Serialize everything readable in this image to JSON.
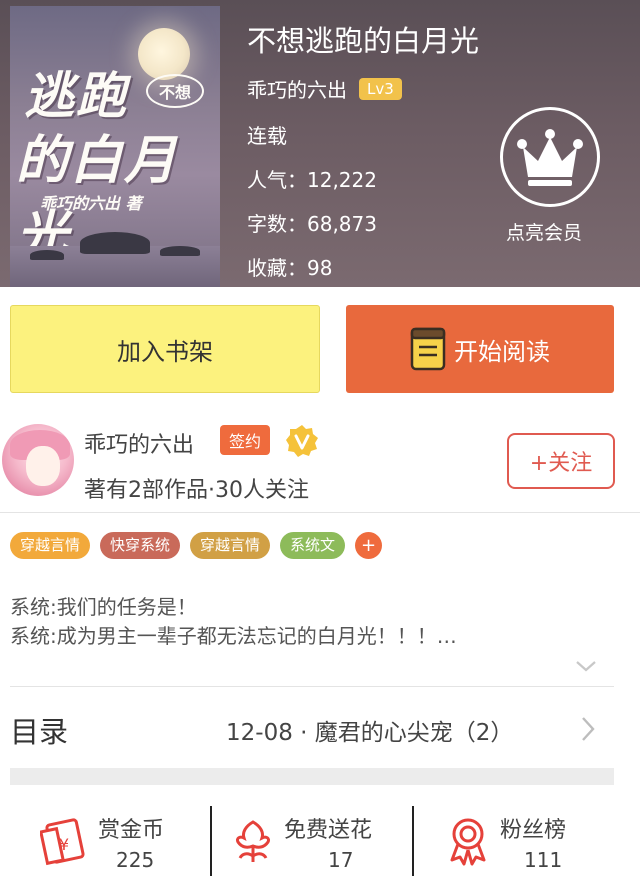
{
  "book": {
    "title": "不想逃跑的白月光",
    "author": "乖巧的六出",
    "level": "Lv3",
    "status": "连载",
    "popularity": "人气：12,222",
    "word_count": "字数：68,873",
    "favorites": "收藏：98",
    "cover": {
      "line1": "逃跑",
      "badge": "不想",
      "line2": "的白月光",
      "author": "乖巧的六出 著"
    }
  },
  "vip": {
    "label": "点亮会员",
    "icon": "crown-icon"
  },
  "actions": {
    "add_shelf": "加入书架",
    "start_read": "开始阅读",
    "read_icon": "book-icon"
  },
  "author_info": {
    "name": "乖巧的六出",
    "signed": "签约",
    "stats": "著有2部作品·30人关注",
    "follow": "+关注",
    "verified_icon": "v-badge-icon"
  },
  "tags": [
    {
      "label": "穿越言情",
      "color": "#f2a93b"
    },
    {
      "label": "快穿系统",
      "color": "#c96a5a"
    },
    {
      "label": "穿越言情",
      "color": "#d1a045"
    },
    {
      "label": "系统文",
      "color": "#8dbb5a"
    }
  ],
  "tag_more": "+",
  "description": {
    "line1": "系统:我们的任务是！",
    "line2": "系统:成为男主一辈子都无法忘记的白月光！！！…"
  },
  "toc": {
    "title": "目录",
    "latest": "12-08 · 魔君的心尖宠（2）"
  },
  "stats": [
    {
      "label": "赏金币",
      "value": "225",
      "icon": "red-envelope-icon"
    },
    {
      "label": "免费送花",
      "value": "17",
      "icon": "flower-icon"
    },
    {
      "label": "粉丝榜",
      "value": "111",
      "icon": "medal-icon"
    }
  ],
  "colors": {
    "accent": "#e8693d",
    "shelf": "#fcf27e",
    "icon_red": "#e5413a",
    "vip_badge": "#f2c24b"
  }
}
